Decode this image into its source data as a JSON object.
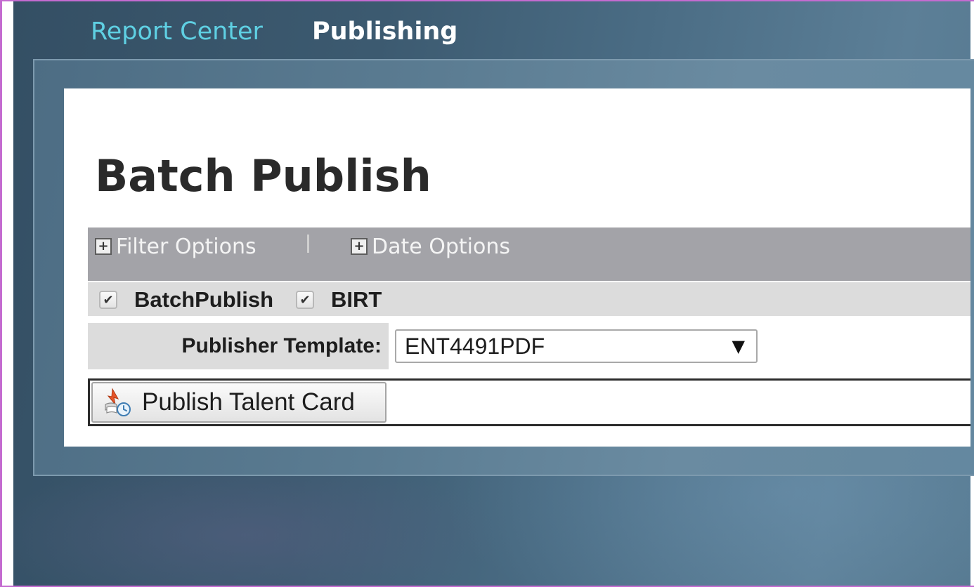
{
  "nav": {
    "report_center": "Report Center",
    "publishing": "Publishing"
  },
  "page": {
    "title": "Batch Publish"
  },
  "options": {
    "filter_label": "Filter Options",
    "date_label": "Date Options",
    "expand_glyph": "+"
  },
  "checkboxes": {
    "batch_publish": {
      "label": "BatchPublish",
      "checked": true
    },
    "birt": {
      "label": "BIRT",
      "checked": true
    },
    "check_glyph": "✔"
  },
  "template": {
    "label": "Publisher Template:",
    "value": "ENT4491PDF",
    "arrow_glyph": "▼"
  },
  "actions": {
    "publish_label": "Publish Talent Card",
    "publish_icon": "publish-talent-card-icon"
  },
  "colors": {
    "nav_link": "#5fd0e3",
    "nav_active": "#ffffff",
    "options_bar": "#a3a3a8",
    "row_bg": "#dcdcdc",
    "frame_border": "#c46bd0"
  }
}
